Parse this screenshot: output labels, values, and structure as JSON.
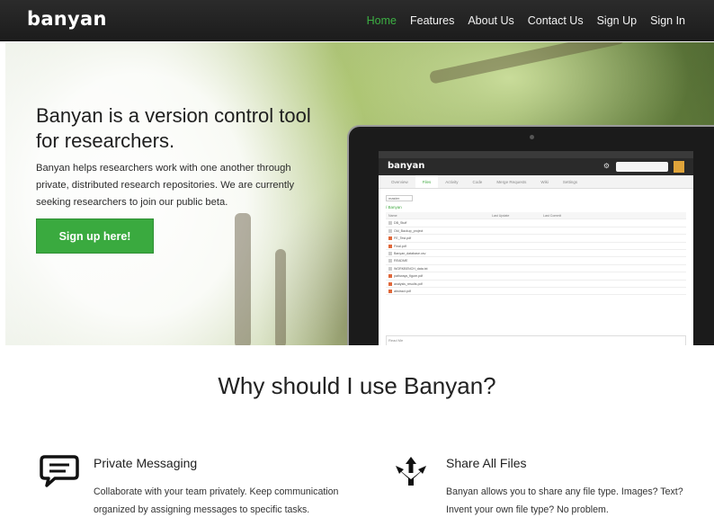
{
  "brand": "banyan",
  "nav": [
    {
      "label": "Home",
      "active": true
    },
    {
      "label": "Features",
      "active": false
    },
    {
      "label": "About Us",
      "active": false
    },
    {
      "label": "Contact Us",
      "active": false
    },
    {
      "label": "Sign Up",
      "active": false
    },
    {
      "label": "Sign In",
      "active": false
    }
  ],
  "colors": {
    "accent": "#3aaa3f",
    "nav_bg": "#222222",
    "nav_active": "#3cb043"
  },
  "hero": {
    "title": "Banyan is a version control tool for researchers.",
    "description": "Banyan helps researchers work with one another through private, distributed research repositories. We are currently seeking researchers to join our public beta.",
    "cta_label": "Sign up here!"
  },
  "laptop_screen": {
    "brand": "banyan",
    "tabs": [
      "Files",
      "Overview",
      "Activity",
      "Code",
      "Merge Requests",
      "Wiki",
      "Settings"
    ],
    "active_tab": "Files",
    "branch": "master",
    "path": "/ Banyan",
    "table_headers": [
      "Name",
      "Last Update",
      "Last Commit"
    ],
    "files": [
      {
        "name": "DB_Stuff",
        "color": "#cccccc"
      },
      {
        "name": "Old_Backup_project",
        "color": "#cccccc"
      },
      {
        "name": "FE_Test.pdf",
        "color": "#e0683a"
      },
      {
        "name": "Final.pdf",
        "color": "#e0683a"
      },
      {
        "name": "Banyan_database.csv",
        "color": "#cccccc"
      },
      {
        "name": "README",
        "color": "#cccccc"
      },
      {
        "name": "WORKBENCH_data.txt",
        "color": "#cccccc"
      },
      {
        "name": "pathways_figure.pdf",
        "color": "#e0683a"
      },
      {
        "name": "analysis_results.pdf",
        "color": "#e0683a"
      },
      {
        "name": "abstract.pdf",
        "color": "#e0683a"
      }
    ],
    "readme_label": "Read Me"
  },
  "why": {
    "title": "Why should I use Banyan?",
    "features": [
      {
        "icon": "chat-bubble-icon",
        "title": "Private Messaging",
        "description": "Collaborate with your team privately. Keep communication organized by assigning messages to specific tasks."
      },
      {
        "icon": "share-arrows-icon",
        "title": "Share All Files",
        "description": "Banyan allows you to share any file type. Images? Text? Invent your own file type? No problem."
      }
    ]
  }
}
